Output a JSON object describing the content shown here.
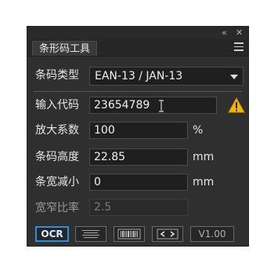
{
  "panel": {
    "title": "条形码工具",
    "header_icons": [
      "collapse-double-left-icon",
      "close-icon"
    ],
    "menu_icon": "hamburger-menu-icon"
  },
  "form": {
    "type_label": "条码类型",
    "type_value": "EAN-13 / JAN-13",
    "code_label": "输入代码",
    "code_value": "23654789",
    "scale_label": "放大系数",
    "scale_value": "100",
    "scale_unit": "%",
    "height_label": "条码高度",
    "height_value": "22.85",
    "height_unit": "mm",
    "reduce_label": "条宽减小",
    "reduce_value": "0",
    "reduce_unit": "mm",
    "ratio_label": "宽窄比率",
    "ratio_value": "2.5"
  },
  "buttons": {
    "ocr_label": "OCR",
    "version_label": "V1.00"
  },
  "colors": {
    "panel_bg": "#2f2f2f",
    "ocr_border": "#2e8fe0",
    "warning": "#f2b705"
  }
}
